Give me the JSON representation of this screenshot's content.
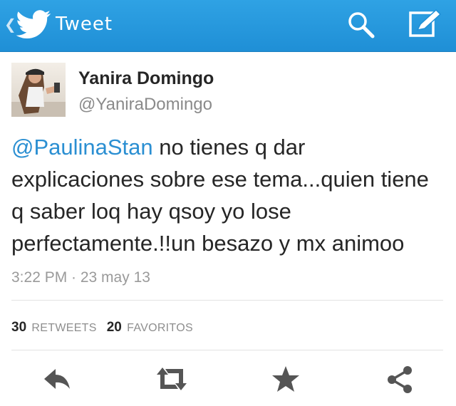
{
  "header": {
    "title": "Tweet",
    "back_icon": "back-chevron-icon",
    "logo_icon": "twitter-bird-icon",
    "search_icon": "search-icon",
    "compose_icon": "compose-icon",
    "background_color": "#2fa2e4"
  },
  "author": {
    "name": "Yanira Domingo",
    "handle": "@YaniraDomingo"
  },
  "tweet": {
    "mention": "@PaulinaStan",
    "line1": " no tienes q dar",
    "line2": "explicaciones sobre ese tema...quien tiene",
    "line3": "q saber loq hay qsoy yo lose",
    "line4": "perfectamente.!!un besazo y mx animoo",
    "mention_color": "#2b8fd2"
  },
  "meta": {
    "timestamp": "3:22 PM · 23 may 13"
  },
  "stats": {
    "retweets_count": "30",
    "retweets_label": "RETWEETS",
    "favorites_count": "20",
    "favorites_label": "FAVORITOS"
  },
  "actions": [
    "reply-icon",
    "retweet-icon",
    "favorite-star-icon",
    "share-icon"
  ]
}
